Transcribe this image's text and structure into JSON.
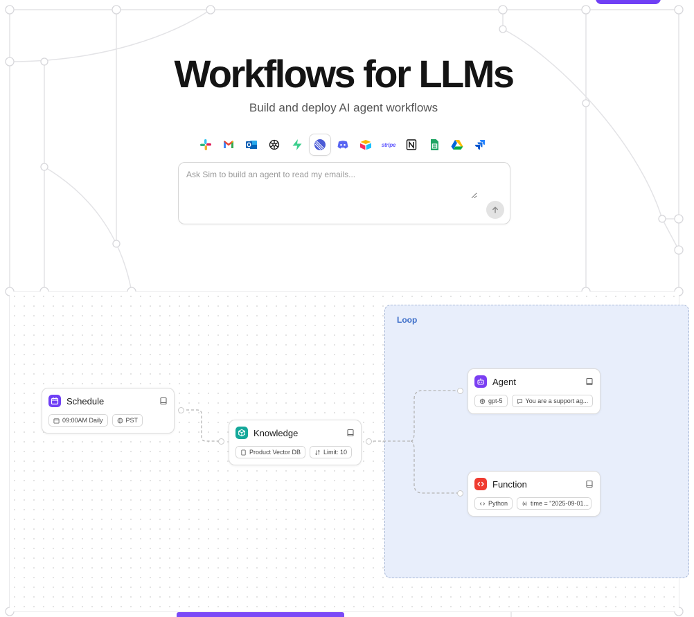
{
  "hero": {
    "title": "Workflows for LLMs",
    "subtitle": "Build and deploy AI agent workflows"
  },
  "integrations": [
    {
      "name": "slack-icon"
    },
    {
      "name": "gmail-icon"
    },
    {
      "name": "outlook-icon"
    },
    {
      "name": "openai-icon"
    },
    {
      "name": "supabase-icon"
    },
    {
      "name": "linear-icon",
      "active": true
    },
    {
      "name": "discord-icon"
    },
    {
      "name": "airtable-icon"
    },
    {
      "name": "stripe-icon",
      "label": "stripe"
    },
    {
      "name": "notion-icon"
    },
    {
      "name": "google-sheets-icon"
    },
    {
      "name": "google-drive-icon"
    },
    {
      "name": "jira-icon"
    }
  ],
  "prompt": {
    "placeholder": "Ask Sim to build an agent to read my emails...",
    "value": ""
  },
  "workflow": {
    "loop_label": "Loop",
    "blocks": {
      "schedule": {
        "title": "Schedule",
        "icon": "calendar-icon",
        "color": "#6f3ff5",
        "chips": [
          "09:00AM Daily",
          "PST"
        ]
      },
      "knowledge": {
        "title": "Knowledge",
        "icon": "cube-icon",
        "color": "#14a89a",
        "chips": [
          "Product Vector DB",
          "Limit: 10"
        ]
      },
      "agent": {
        "title": "Agent",
        "icon": "robot-icon",
        "color": "#7b3ff2",
        "chips": [
          "gpt-5",
          "You are a support ag..."
        ]
      },
      "function": {
        "title": "Function",
        "icon": "code-icon",
        "color": "#ef3b30",
        "chips": [
          "Python",
          "time = \"2025-09-01..."
        ]
      }
    }
  },
  "colors": {
    "accent": "#6f3ff5",
    "loop_bg": "#e8eefb",
    "loop_border": "#a6b6d6",
    "loop_label": "#3d6ec9"
  }
}
